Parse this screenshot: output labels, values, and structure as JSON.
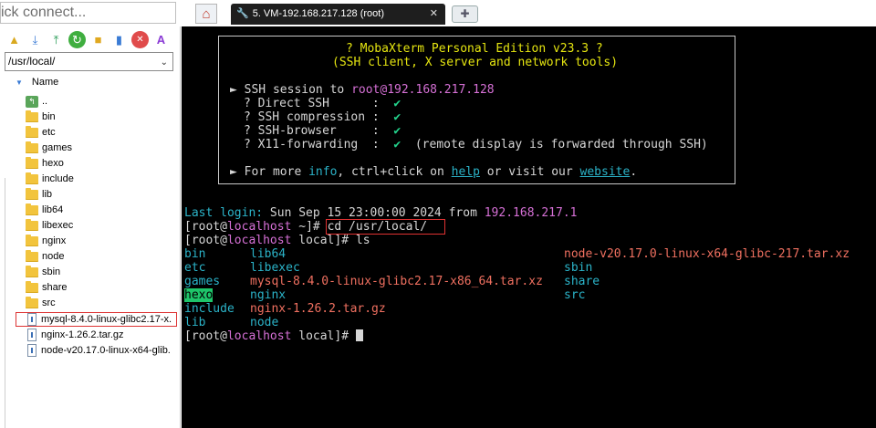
{
  "sidebar": {
    "quick_connect_placeholder": "ick connect...",
    "path": "/usr/local/",
    "header_name": "Name",
    "items": [
      {
        "name": "..",
        "kind": "up"
      },
      {
        "name": "bin",
        "kind": "folder"
      },
      {
        "name": "etc",
        "kind": "folder"
      },
      {
        "name": "games",
        "kind": "folder"
      },
      {
        "name": "hexo",
        "kind": "folder"
      },
      {
        "name": "include",
        "kind": "folder"
      },
      {
        "name": "lib",
        "kind": "folder"
      },
      {
        "name": "lib64",
        "kind": "folder"
      },
      {
        "name": "libexec",
        "kind": "folder"
      },
      {
        "name": "nginx",
        "kind": "folder"
      },
      {
        "name": "node",
        "kind": "folder"
      },
      {
        "name": "sbin",
        "kind": "folder"
      },
      {
        "name": "share",
        "kind": "folder"
      },
      {
        "name": "src",
        "kind": "folder"
      },
      {
        "name": "mysql-8.4.0-linux-glibc2.17-x.",
        "kind": "file"
      },
      {
        "name": "nginx-1.26.2.tar.gz",
        "kind": "file"
      },
      {
        "name": "node-v20.17.0-linux-x64-glib.",
        "kind": "file"
      }
    ]
  },
  "tabs": {
    "active_label": "5. VM-192.168.217.128 (root)",
    "close": "✕"
  },
  "terminal": {
    "banner_title": "? MobaXterm Personal Edition v23.3 ?",
    "banner_sub": "(SSH client, X server and network tools)",
    "ssh_prefix": "► SSH session to ",
    "ssh_target": "root@192.168.217.128",
    "opt1": "? Direct SSH      :  ",
    "opt2": "? SSH compression :  ",
    "opt3": "? SSH-browser     :  ",
    "opt4": "? X11-forwarding  :  ",
    "check": "✔",
    "x11_note": "  (remote display is forwarded through SSH)",
    "info_prefix": "► For more ",
    "info_word": "info",
    "info_mid": ", ctrl+click on ",
    "help_word": "help",
    "info_mid2": " or visit our ",
    "website_word": "website",
    "info_end": ".",
    "last_login_label": "Last login:",
    "last_login_text": " Sun Sep 15 23:00:00 2024 from ",
    "last_login_ip": "192.168.217.1",
    "prompt_open": "[root@",
    "prompt_host": "localhost",
    "prompt1_dir": " ~]# ",
    "cmd1": "cd /usr/local/",
    "prompt2_dir": " local]# ",
    "cmd2": "ls",
    "ls": {
      "bin": "bin",
      "etc": "etc",
      "games": "games",
      "hexo": "hexo",
      "include": "include",
      "lib": "lib",
      "lib64": "lib64",
      "libexec": "libexec",
      "mysql": "mysql-8.4.0-linux-glibc2.17-x86_64.tar.xz",
      "nginx": "nginx",
      "nginx_gz": "nginx-1.26.2.tar.gz",
      "node": "node",
      "node_xz": "node-v20.17.0-linux-x64-glibc-217.tar.xz",
      "sbin": "sbin",
      "share": "share",
      "src": "src"
    },
    "prompt3_dir": " local]# "
  }
}
